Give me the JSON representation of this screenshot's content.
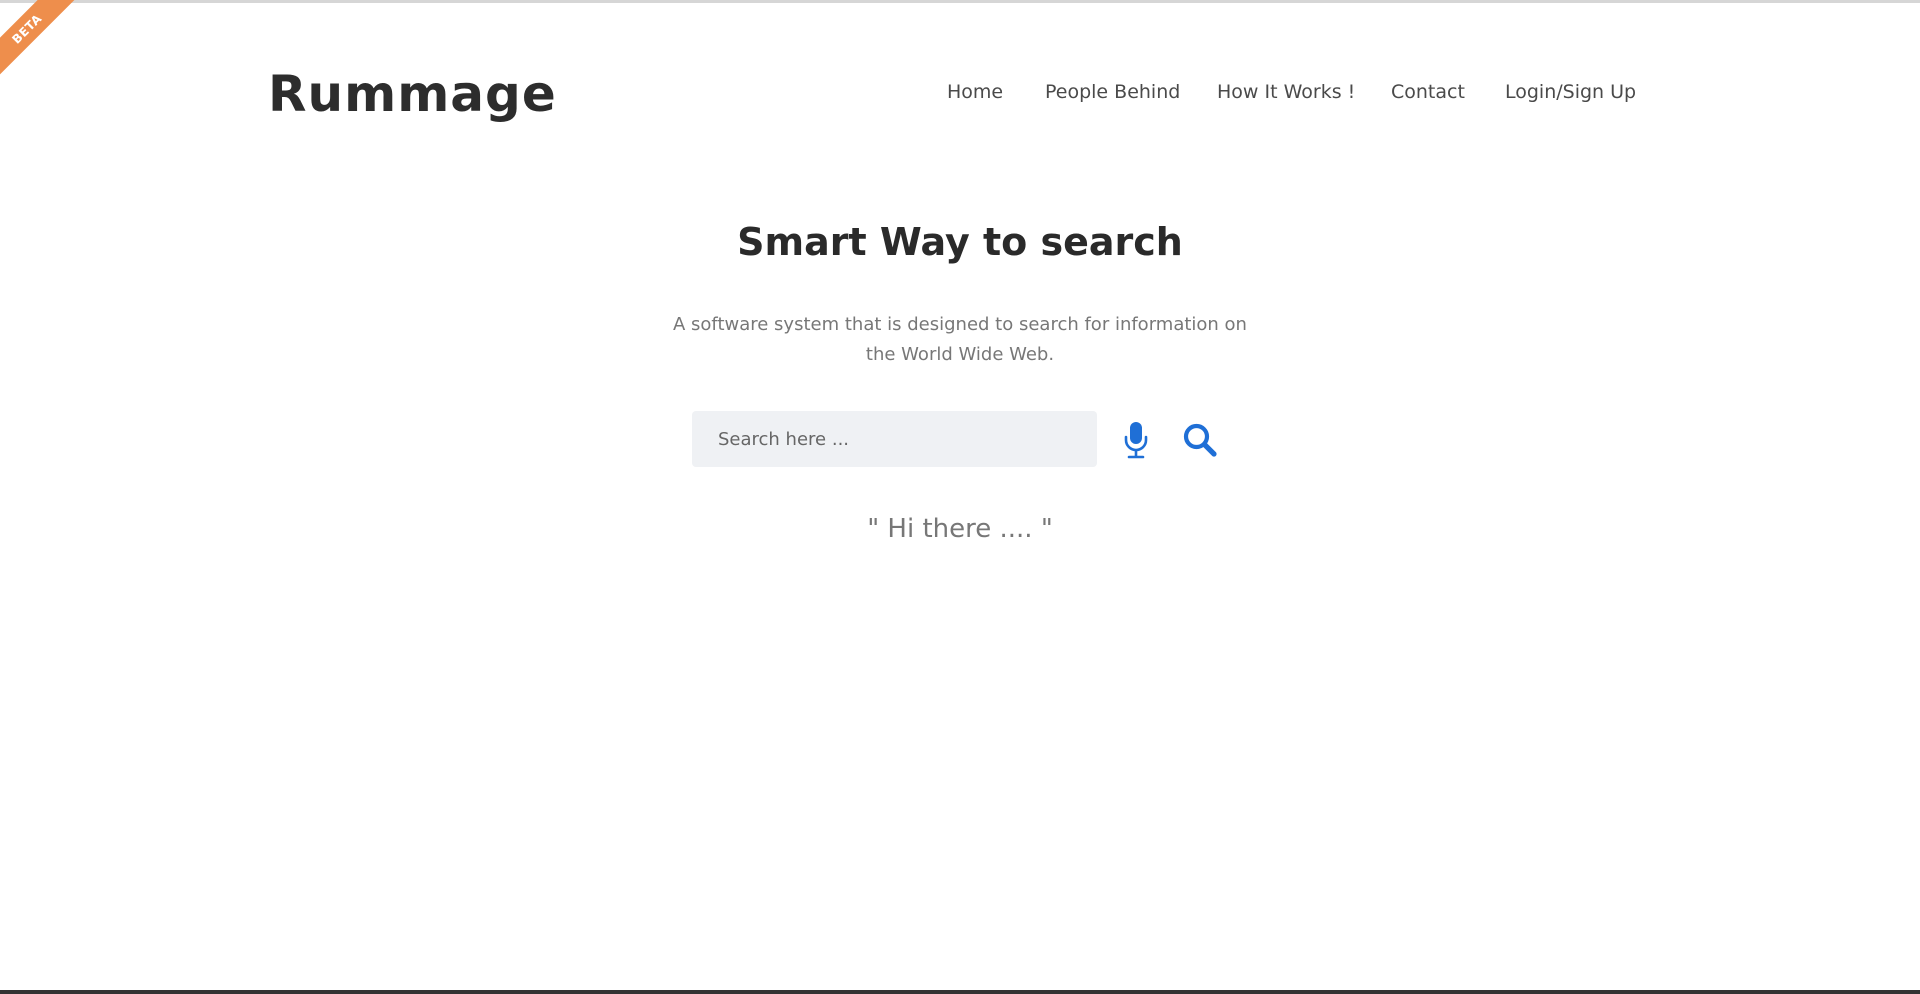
{
  "badge": {
    "label": "BETA",
    "color": "#ee8e4c"
  },
  "brand": {
    "name": "Rummage"
  },
  "nav": {
    "items": [
      {
        "label": "Home"
      },
      {
        "label": "People Behind"
      },
      {
        "label": "How It Works !"
      },
      {
        "label": "Contact"
      },
      {
        "label": "Login/Sign Up"
      }
    ]
  },
  "hero": {
    "title": "Smart Way to search",
    "subtitle": "A software system that is designed to search for information on the World Wide Web."
  },
  "search": {
    "placeholder": "Search here ...",
    "value": "",
    "mic_icon": "microphone-icon",
    "search_icon": "search-icon",
    "accent_color": "#1f6fd6"
  },
  "greeting": {
    "text": "\" Hi there .... \""
  }
}
